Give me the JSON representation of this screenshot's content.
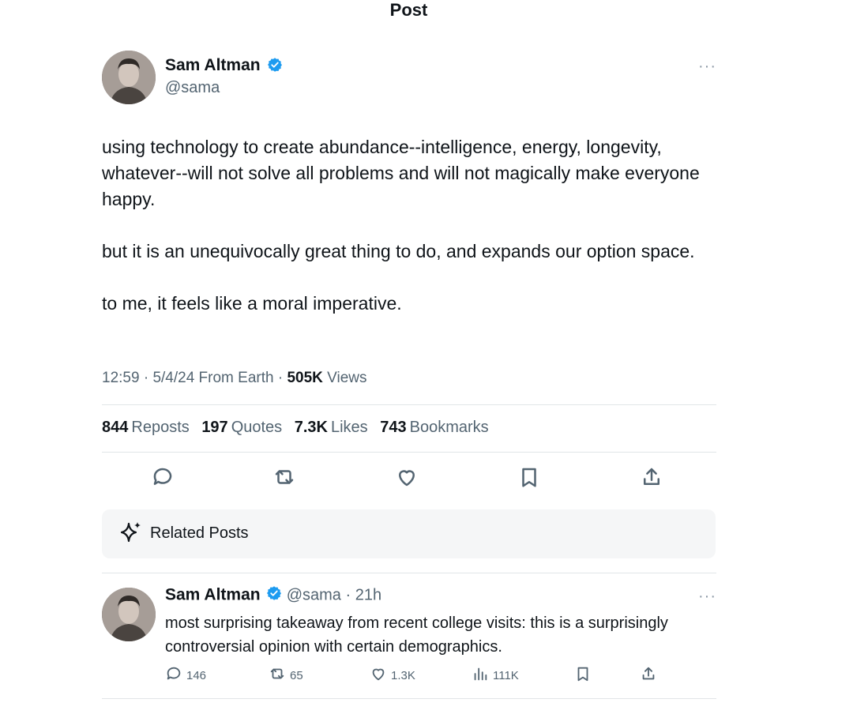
{
  "header": {
    "title": "Post"
  },
  "post": {
    "author": {
      "name": "Sam Altman",
      "handle": "@sama",
      "avatar_icon": "profile-photo"
    },
    "more_label": "···",
    "paragraphs": [
      "using technology to create abundance--intelligence, energy, longevity, whatever--will not solve all problems and will not magically make everyone happy.",
      "but it is an unequivocally great thing to do, and expands our option space.",
      "to me, it feels like a moral imperative."
    ],
    "meta": {
      "time": "12:59",
      "sep1": "·",
      "date": "5/4/24",
      "source": "From Earth",
      "sep2": "·",
      "views_count": "505K",
      "views_label": "Views"
    },
    "stats": [
      {
        "count": "844",
        "label": "Reposts"
      },
      {
        "count": "197",
        "label": "Quotes"
      },
      {
        "count": "7.3K",
        "label": "Likes"
      },
      {
        "count": "743",
        "label": "Bookmarks"
      }
    ],
    "actions": [
      "reply-icon",
      "repost-icon",
      "like-icon",
      "bookmark-icon",
      "share-icon"
    ]
  },
  "related": {
    "label": "Related Posts",
    "icon": "sparkle-icon"
  },
  "reply": {
    "name": "Sam Altman",
    "handle": "@sama",
    "sep": "·",
    "time": "21h",
    "more_label": "···",
    "text": "most surprising takeaway from recent college visits: this is a surprisingly controversial opinion with certain demographics.",
    "counts": {
      "replies": "146",
      "reposts": "65",
      "likes": "1.3K",
      "views": "111K"
    }
  },
  "colors": {
    "verified": "#1d9bf0",
    "secondary_text": "#536471",
    "primary_text": "#0f1419"
  }
}
